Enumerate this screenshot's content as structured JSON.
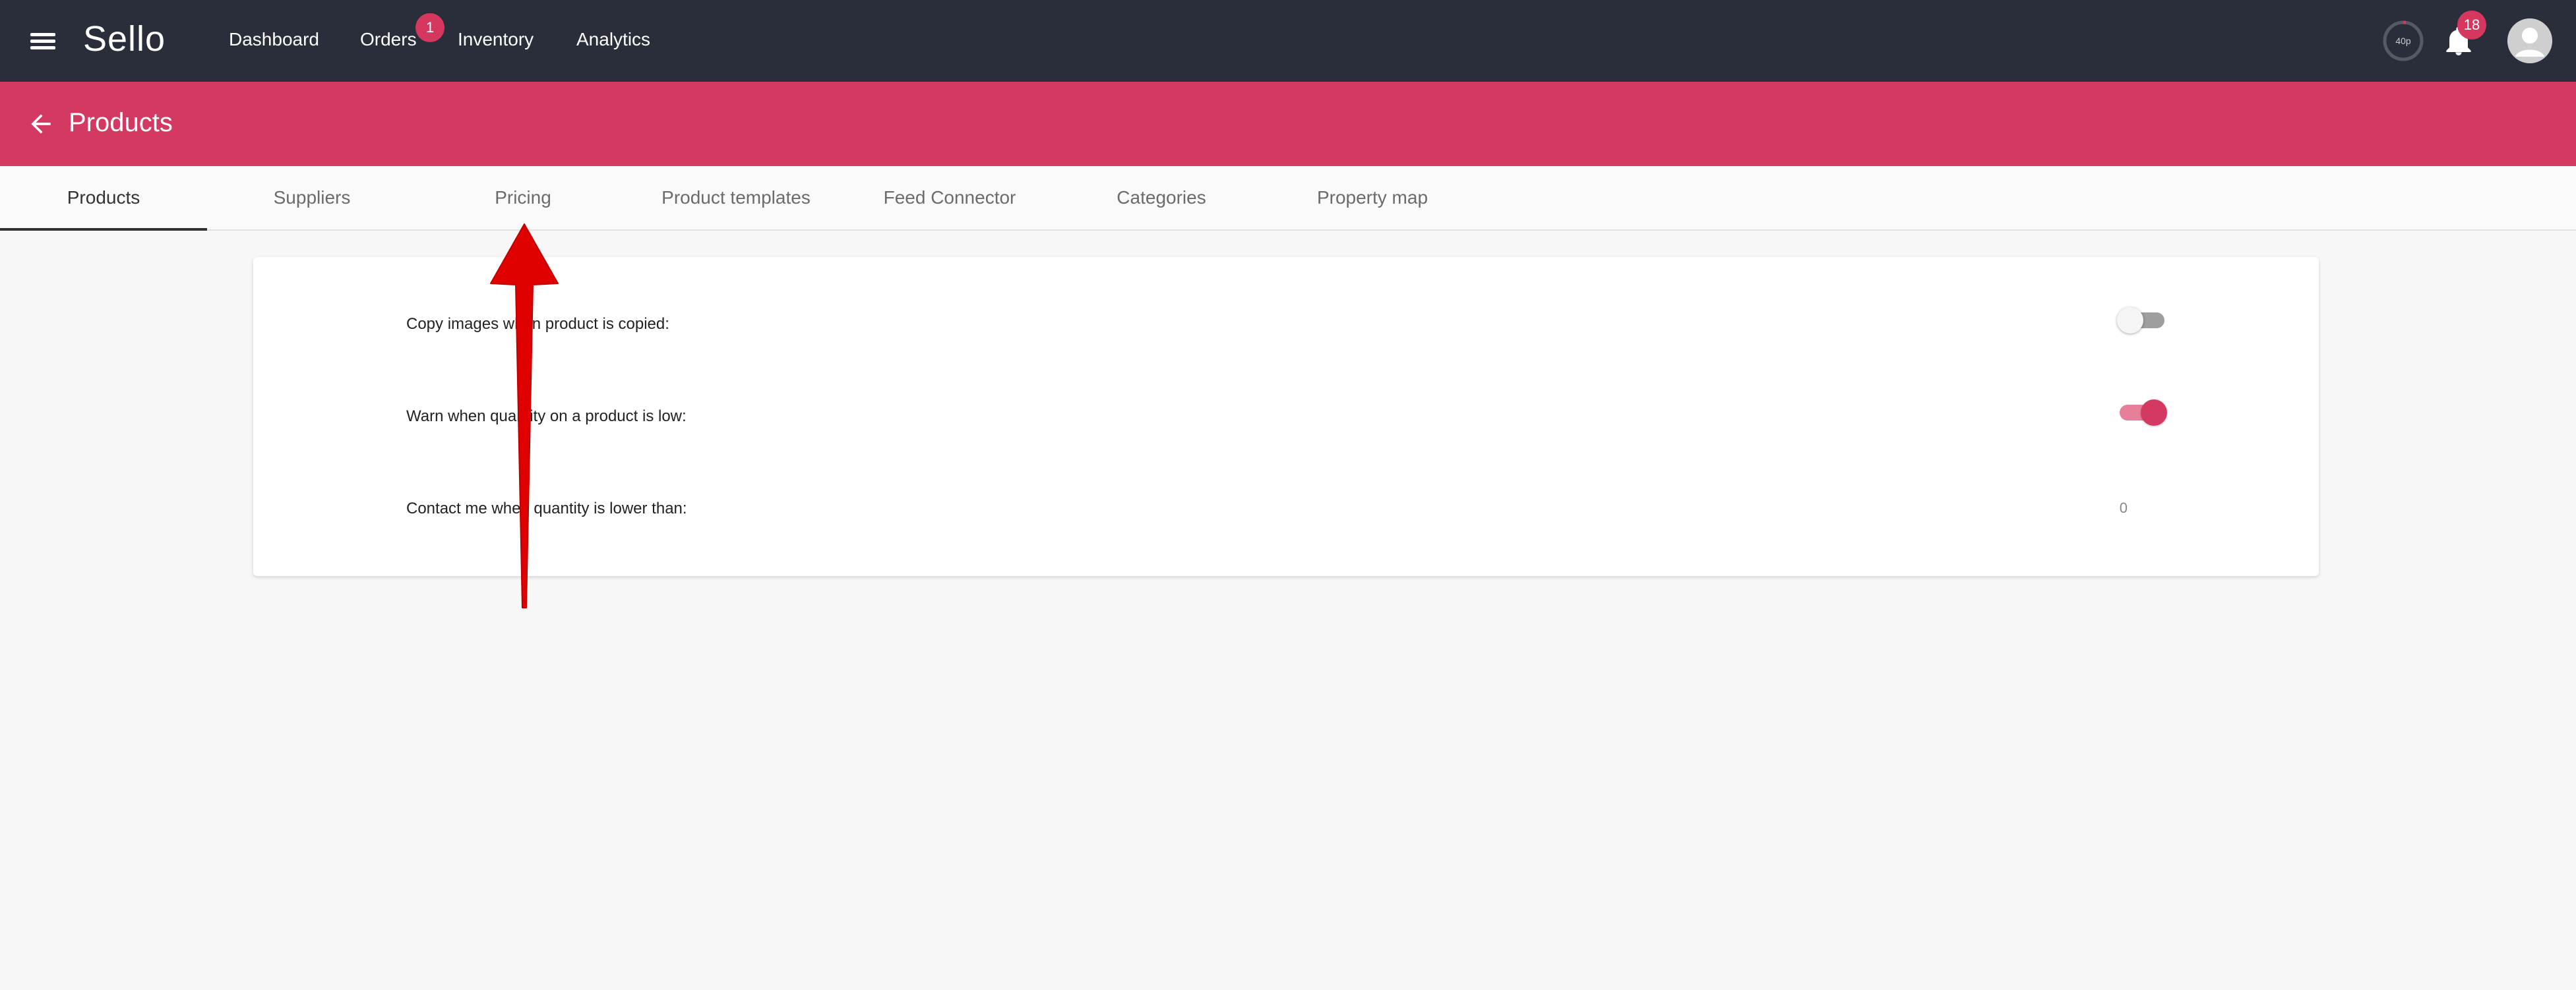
{
  "app": {
    "name": "Sello",
    "nav": [
      {
        "label": "Dashboard"
      },
      {
        "label": "Orders",
        "badge": "1"
      },
      {
        "label": "Inventory"
      },
      {
        "label": "Analytics"
      }
    ],
    "progress_label": "40p",
    "notifications_count": "18"
  },
  "header": {
    "title": "Products"
  },
  "tabs": [
    {
      "label": "Products",
      "active": true
    },
    {
      "label": "Suppliers"
    },
    {
      "label": "Pricing"
    },
    {
      "label": "Product templates"
    },
    {
      "label": "Feed Connector"
    },
    {
      "label": "Categories"
    },
    {
      "label": "Property map"
    }
  ],
  "settings": {
    "copy_images": {
      "label": "Copy images when product is copied:",
      "enabled": false
    },
    "warn_low_qty": {
      "label": "Warn when quantity on a product is low:",
      "enabled": true
    },
    "contact_threshold": {
      "label": "Contact me when quantity is lower than:",
      "value": "0"
    }
  },
  "colors": {
    "topbar": "#2a2d3a",
    "accent": "#d43961",
    "annotation": "#e10000"
  },
  "icons": [
    "menu-icon",
    "arrow-back-icon",
    "bell-icon",
    "account-circle-icon",
    "progress-ring-icon"
  ]
}
